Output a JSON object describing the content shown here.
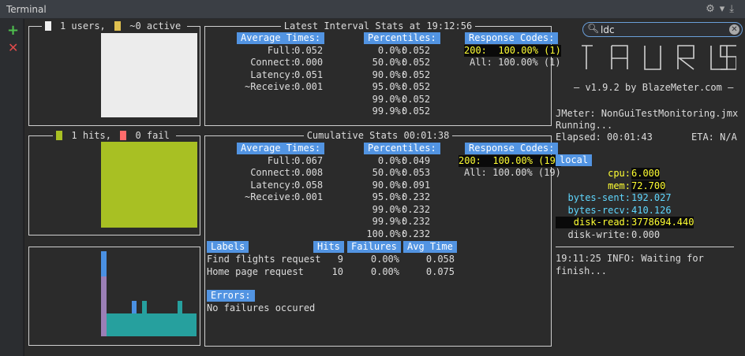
{
  "window": {
    "title": "Terminal"
  },
  "search": {
    "value": "ldc"
  },
  "users_box": {
    "title_users": "1 users,",
    "title_active": "~0 active",
    "color_users": "#f0f0f0",
    "color_active": "#e0c050"
  },
  "hits_box": {
    "title_hits": "1 hits,",
    "title_fail": "0 fail",
    "color_hits": "#a8c023",
    "color_fail": "#ff6b6b"
  },
  "latest": {
    "title": "Latest Interval Stats at 19:12:56",
    "avg_header": "Average Times:",
    "avg": [
      {
        "label": "Full:",
        "value": "0.052"
      },
      {
        "label": "Connect:",
        "value": "0.000"
      },
      {
        "label": "Latency:",
        "value": "0.051"
      },
      {
        "label": "~Receive:",
        "value": "0.001"
      }
    ],
    "pct_header": "Percentiles:",
    "pct": [
      {
        "label": "0.0%:",
        "value": "0.052"
      },
      {
        "label": "50.0%:",
        "value": "0.052"
      },
      {
        "label": "90.0%:",
        "value": "0.052"
      },
      {
        "label": "95.0%:",
        "value": "0.052"
      },
      {
        "label": "99.0%:",
        "value": "0.052"
      },
      {
        "label": "99.9%:",
        "value": "0.052"
      }
    ],
    "rc_header": "Response Codes:",
    "rc_200": "200:  100.00% (1)",
    "rc_all": "All: 100.00% (1)"
  },
  "cumulative": {
    "title": "Cumulative Stats 00:01:38",
    "avg_header": "Average Times:",
    "avg": [
      {
        "label": "Full:",
        "value": "0.067"
      },
      {
        "label": "Connect:",
        "value": "0.008"
      },
      {
        "label": "Latency:",
        "value": "0.058"
      },
      {
        "label": "~Receive:",
        "value": "0.001"
      }
    ],
    "pct_header": "Percentiles:",
    "pct": [
      {
        "label": "0.0%:",
        "value": "0.049"
      },
      {
        "label": "50.0%:",
        "value": "0.053"
      },
      {
        "label": "90.0%:",
        "value": "0.091"
      },
      {
        "label": "95.0%:",
        "value": "0.232"
      },
      {
        "label": "99.0%:",
        "value": "0.232"
      },
      {
        "label": "99.9%:",
        "value": "0.232"
      },
      {
        "label": "100.0%:",
        "value": "0.232"
      }
    ],
    "rc_header": "Response Codes:",
    "rc_200": "200:  100.00% (19)",
    "rc_all": "All: 100.00% (19)"
  },
  "labels_table": {
    "headers": [
      "Labels",
      "Hits",
      "Failures",
      "Avg Time"
    ],
    "rows": [
      {
        "label": "Find flights request",
        "hits": "9",
        "failures": "0.00%",
        "avg": "0.058"
      },
      {
        "label": "Home page request",
        "hits": "10",
        "failures": "0.00%",
        "avg": "0.075"
      }
    ]
  },
  "errors": {
    "header": "Errors:",
    "text": "No failures occured"
  },
  "sidebar": {
    "version": "– v1.9.2 by BlazeMeter.com –",
    "jmeter": "JMeter: NonGuiTestMonitoring.jmx",
    "status": "Running...",
    "elapsed": "Elapsed: 00:01:43",
    "eta": "ETA: N/A",
    "local_header": "local",
    "metrics": [
      {
        "name": "cpu:",
        "value": "6.000",
        "style": "yel"
      },
      {
        "name": "mem:",
        "value": "72.700",
        "style": "yel"
      },
      {
        "name": "bytes-sent:",
        "value": "192.027",
        "style": "cy"
      },
      {
        "name": "bytes-recv:",
        "value": "410.126",
        "style": "cy"
      },
      {
        "name": "disk-read:",
        "value": "3778694.440",
        "style": "yel"
      },
      {
        "name": "disk-write:",
        "value": "0.000",
        "style": "plain"
      }
    ],
    "log1": "19:11:25 INFO: Waiting for",
    "log2": "finish..."
  },
  "colors": {
    "bar_users": "#ececec",
    "bar_hits": "#a8c023",
    "graph_blue": "#4a90e2",
    "graph_purple": "#9b7fb6",
    "graph_teal": "#26a09e"
  }
}
